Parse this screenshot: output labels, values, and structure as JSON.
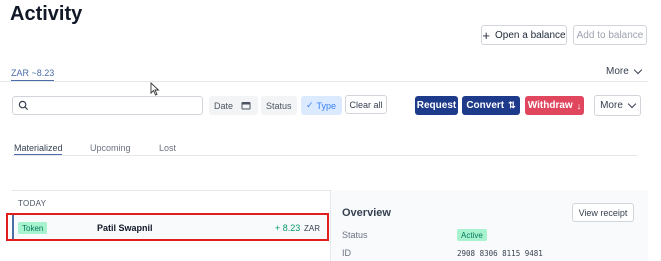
{
  "page": {
    "title": "Activity"
  },
  "header_actions": {
    "open_balance": "Open a balance",
    "add_to_balance": "Add to balance"
  },
  "balance_tabs": {
    "active": "ZAR ~8.23",
    "more": "More"
  },
  "filters": {
    "search_placeholder": "",
    "date": "Date",
    "status": "Status",
    "type": "Type",
    "clear": "Clear all"
  },
  "actions": {
    "request": "Request",
    "convert": "Convert",
    "convert_glyph": "⇅",
    "withdraw": "Withdraw",
    "withdraw_glyph": "↓",
    "more": "More"
  },
  "subtabs": [
    "Materialized",
    "Upcoming",
    "Lost"
  ],
  "list": {
    "group_label": "TODAY",
    "row": {
      "badge": "Token",
      "name": "Patil Swapnil",
      "amount": "+ 8.23",
      "currency": "ZAR"
    }
  },
  "overview": {
    "title": "Overview",
    "view_receipt": "View receipt",
    "status_label": "Status",
    "status_value": "Active",
    "id_label": "ID",
    "id_value": "2908 8306 8115 9481"
  },
  "colors": {
    "primary": "#1e3a8a",
    "danger": "#e0475f",
    "success": "#059669",
    "highlight": "#e11d1d"
  }
}
